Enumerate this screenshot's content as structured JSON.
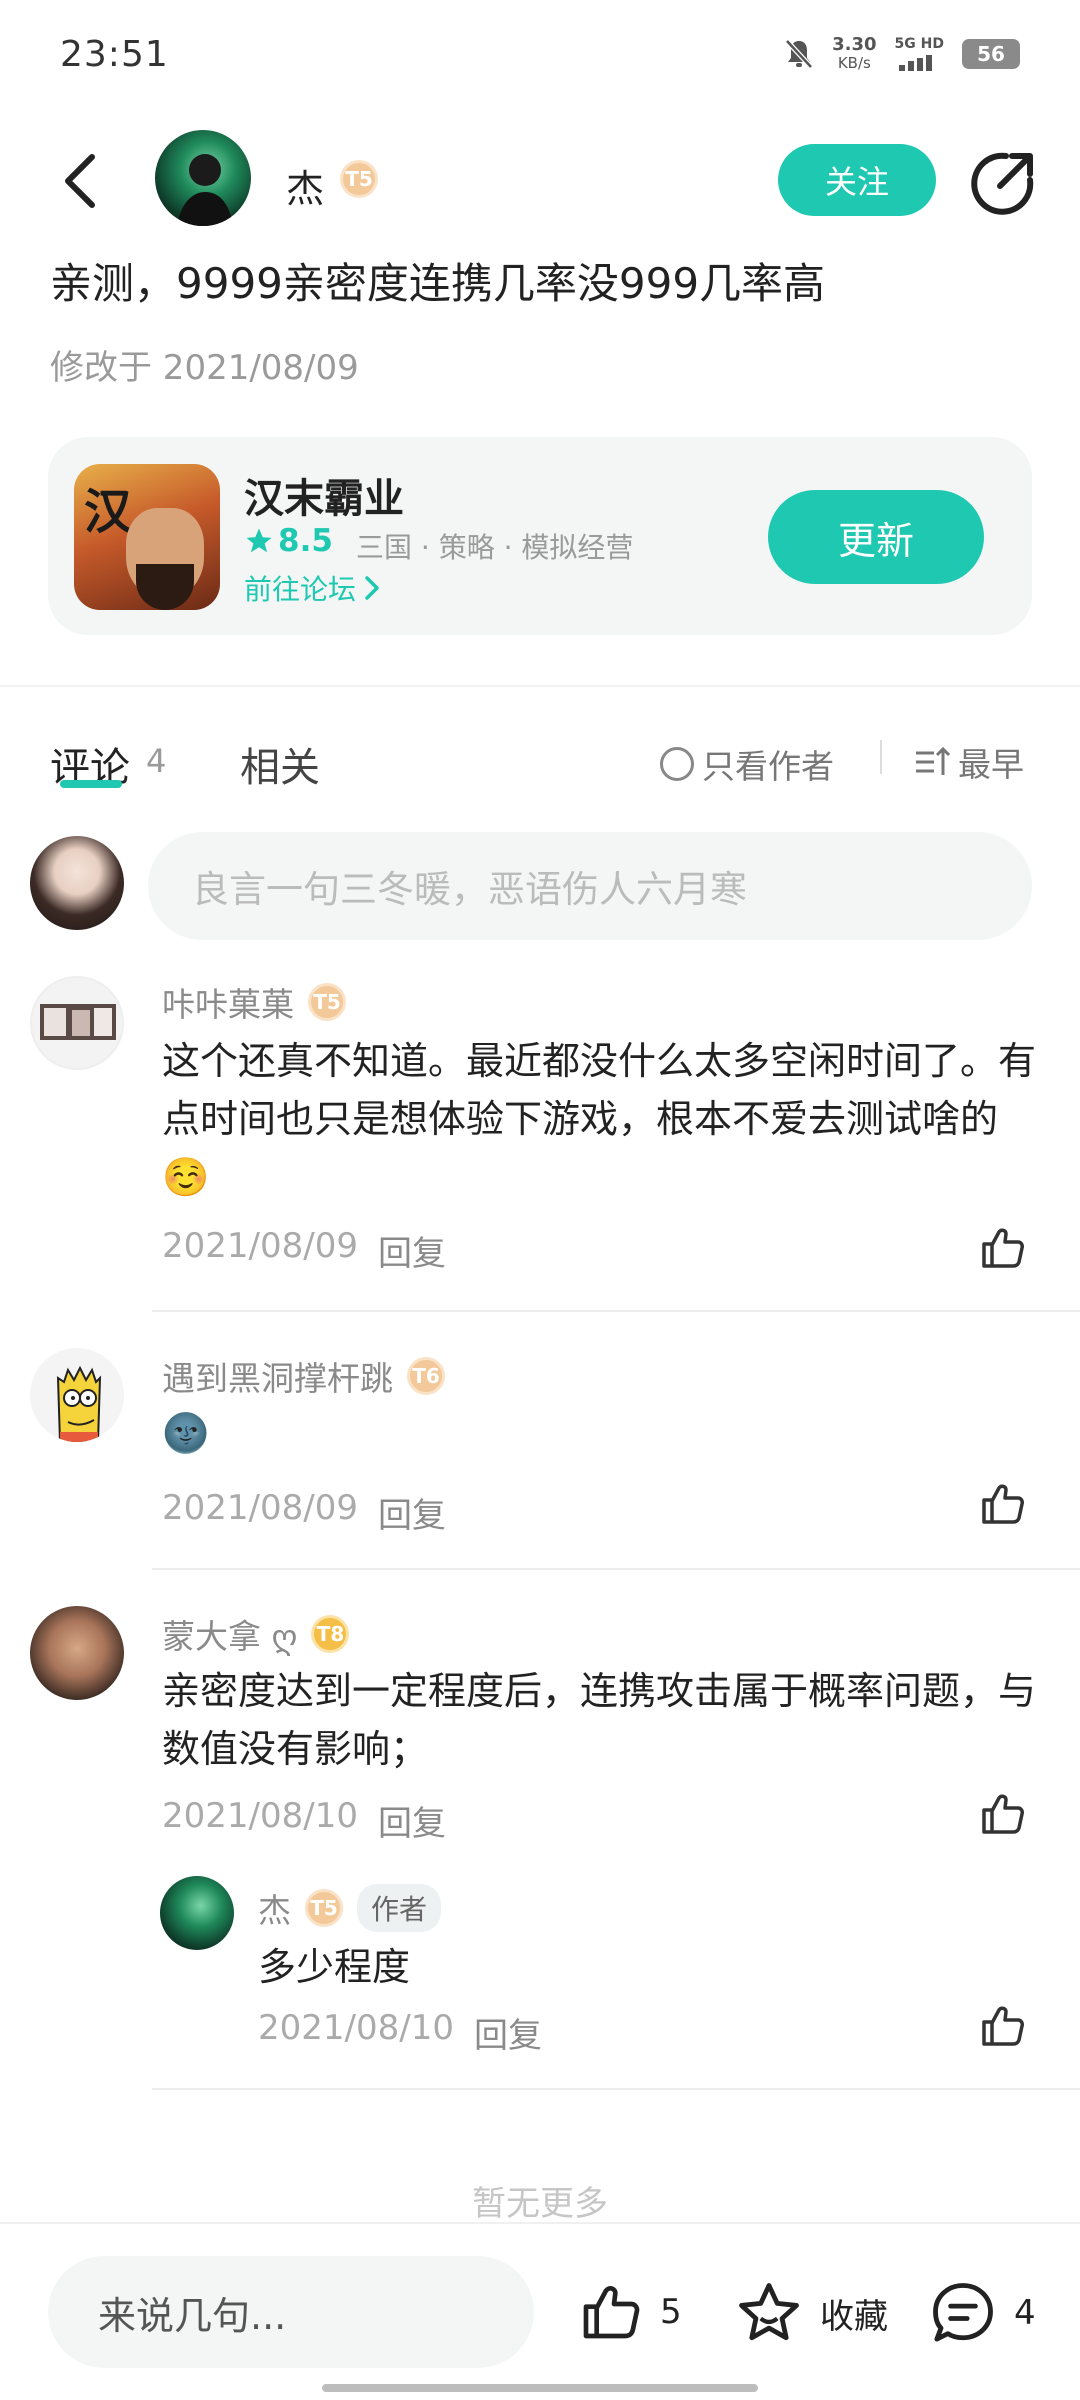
{
  "status_bar": {
    "time": "23:51",
    "net_speed_value": "3.30",
    "net_speed_unit": "KB/s",
    "network_label": "5G HD",
    "battery": "56"
  },
  "header": {
    "author_name": "杰",
    "author_level": "T5",
    "follow_label": "关注"
  },
  "post": {
    "title": "亲测，9999亲密度连携几率没999几率高",
    "date": "修改于 2021/08/09"
  },
  "game_card": {
    "name": "汉末霸业",
    "icon_text": "汉",
    "score": "8.5",
    "tags": "三国 · 策略 · 模拟经营",
    "forum_link": "前往论坛",
    "update_label": "更新"
  },
  "tabs": {
    "comments_label": "评论",
    "comments_count": "4",
    "related_label": "相关",
    "only_author_label": "只看作者",
    "sort_label": "最早"
  },
  "comment_input": {
    "placeholder": "良言一句三冬暖，恶语伤人六月寒"
  },
  "comments": [
    {
      "name": "咔咔菓菓",
      "level": "T5",
      "text": "这个还真不知道。最近都没什么太多空闲时间了。有点时间也只是想体验下游戏，根本不爱去测试啥的☺️",
      "date": "2021/08/09",
      "reply_label": "回复"
    },
    {
      "name": "遇到黑洞撑杆跳",
      "level": "T6",
      "text": "🌚",
      "date": "2021/08/09",
      "reply_label": "回复"
    },
    {
      "name": "蒙大拿",
      "name_suffix": "ღ",
      "level": "T8",
      "text": "亲密度达到一定程度后，连携攻击属于概率问题，与数值没有影响；",
      "date": "2021/08/10",
      "reply_label": "回复",
      "reply": {
        "name": "杰",
        "level": "T5",
        "author_tag": "作者",
        "text": "多少程度",
        "date": "2021/08/10",
        "reply_label": "回复"
      }
    }
  ],
  "end_text": "暂无更多",
  "bottom_bar": {
    "input_placeholder": "来说几句...",
    "like_count": "5",
    "favorite_label": "收藏",
    "comment_count": "4"
  },
  "colors": {
    "accent": "#1fc8b0",
    "level_badge": "#f3c99a"
  }
}
